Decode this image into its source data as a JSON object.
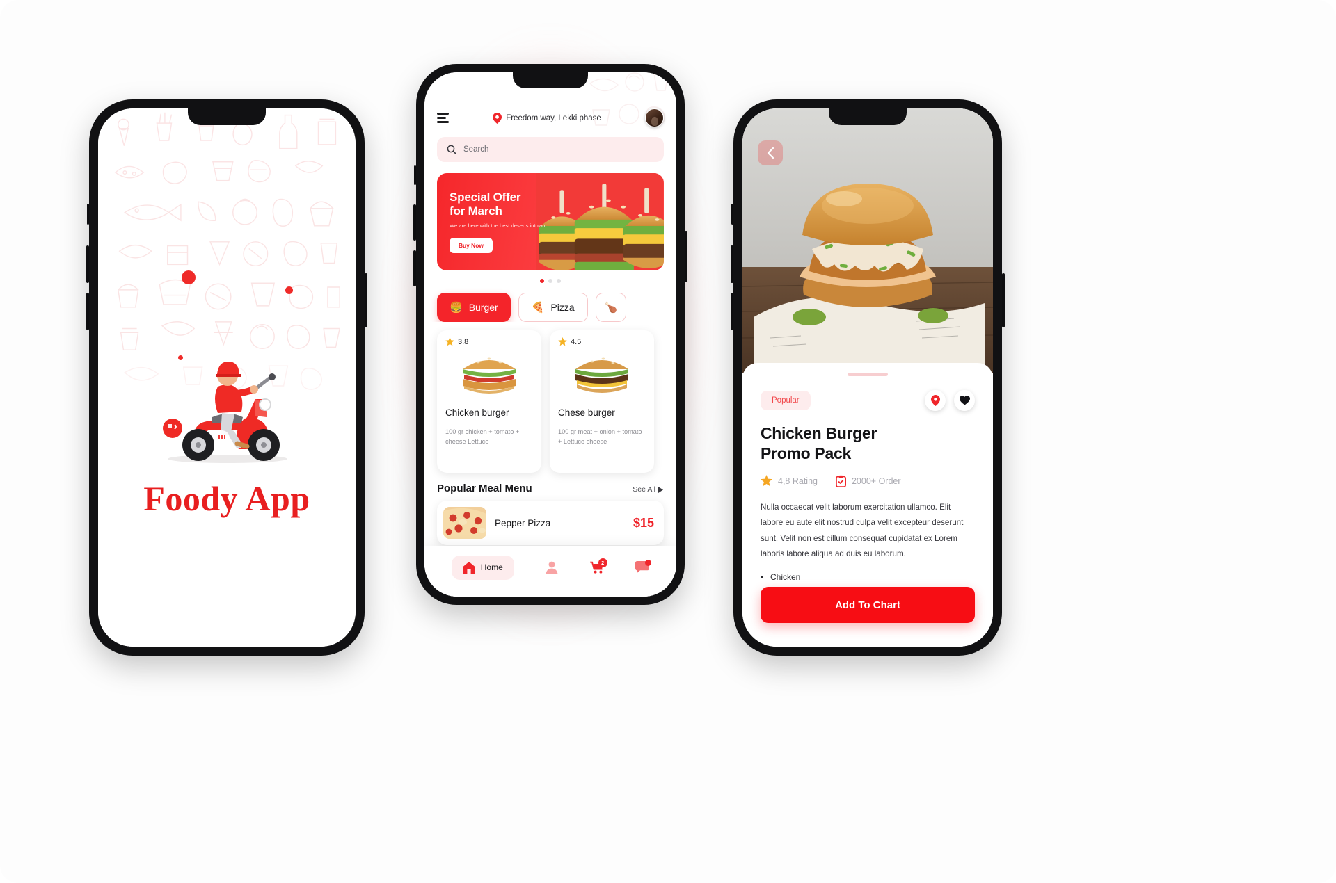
{
  "splash": {
    "app_title": "Foody App",
    "illustration": "delivery-scooter-rider"
  },
  "home": {
    "location": "Freedom way, Lekki phase",
    "menu_icon": "hamburger-menu-icon",
    "pin_icon": "location-pin-icon",
    "avatar": "user-avatar",
    "search": {
      "placeholder": "Search",
      "icon": "search-icon"
    },
    "promo": {
      "title_line1": "Special Offer",
      "title_line2": "for March",
      "subtitle": "We are here with the best deserts intown.",
      "button": "Buy Now"
    },
    "carousel_dots": 3,
    "carousel_active": 0,
    "categories": [
      {
        "label": "Burger",
        "emoji": "🍔",
        "active": true
      },
      {
        "label": "Pizza",
        "emoji": "🍕",
        "active": false
      },
      {
        "label": "",
        "emoji": "🍗",
        "active": false
      }
    ],
    "food_cards": [
      {
        "rating": "3.8",
        "name": "Chicken burger",
        "desc": "100 gr chicken + tomato + cheese  Lettuce"
      },
      {
        "rating": "4.5",
        "name": "Chese burger",
        "desc": "100 gr meat + onion + tomato + Lettuce cheese"
      }
    ],
    "section": {
      "title": "Popular Meal Menu",
      "see_all": "See All"
    },
    "meal": {
      "name": "Pepper Pizza",
      "price": "$15"
    },
    "tabs": [
      {
        "label": "Home",
        "icon": "home-icon",
        "active": true
      },
      {
        "label": "",
        "icon": "profile-icon",
        "active": false
      },
      {
        "label": "",
        "icon": "cart-icon",
        "active": false,
        "badge": "2"
      },
      {
        "label": "",
        "icon": "chat-icon",
        "active": false,
        "badge": ""
      }
    ]
  },
  "detail": {
    "back_icon": "chevron-left-icon",
    "tag": "Popular",
    "actions": [
      {
        "icon": "location-pin-icon"
      },
      {
        "icon": "heart-icon"
      }
    ],
    "title_line1": "Chicken Burger",
    "title_line2": "Promo Pack",
    "rating": "4,8 Rating",
    "orders": "2000+ Order",
    "description": "Nulla occaecat velit laborum exercitation ullamco. Elit labore eu aute elit nostrud culpa velit excepteur deserunt sunt. Velit non est cillum consequat cupidatat ex Lorem laboris labore aliqua ad duis eu laborum.",
    "ingredients": [
      "Chicken"
    ],
    "cta": "Add To Chart"
  },
  "colors": {
    "brand_red": "#f4242a",
    "deep_red": "#ef2229",
    "soft_pink": "#fdeced",
    "star_gold": "#f5b223"
  }
}
